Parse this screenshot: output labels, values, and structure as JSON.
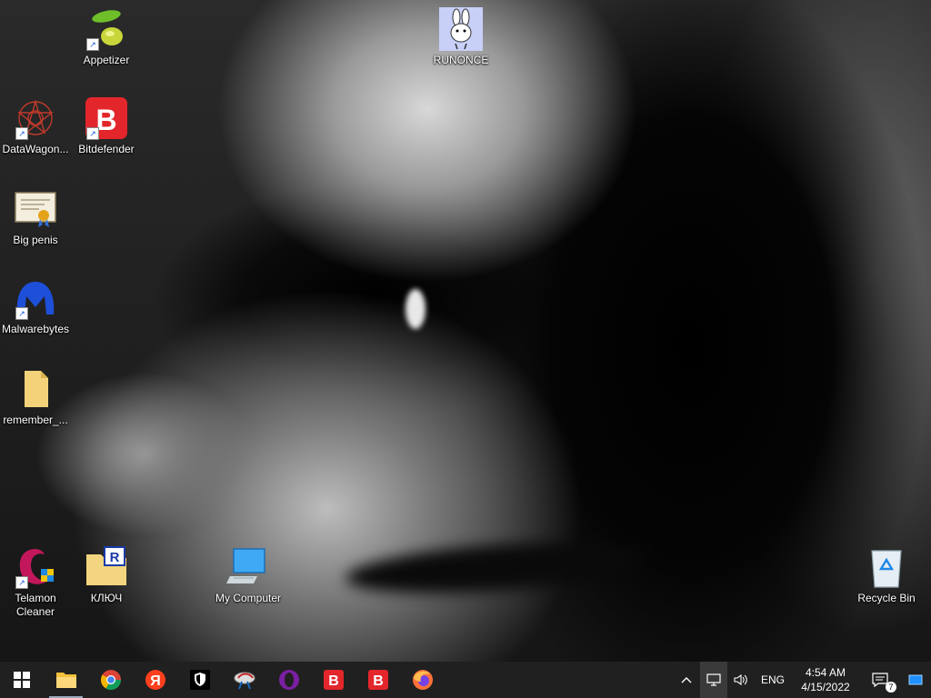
{
  "desktop": {
    "icons": [
      {
        "label": "Appetizer"
      },
      {
        "label": "RUNONCE"
      },
      {
        "label": "DataWagon..."
      },
      {
        "label": "Bitdefender"
      },
      {
        "label": "Big penis"
      },
      {
        "label": "Malwarebytes"
      },
      {
        "label": "remember_..."
      },
      {
        "label": "Telamon Cleaner"
      },
      {
        "label": "КЛЮЧ"
      },
      {
        "label": "My Computer"
      },
      {
        "label": "Recycle Bin"
      }
    ]
  },
  "taskbar": {
    "apps": [
      {
        "icon": "file-explorer-icon"
      },
      {
        "icon": "chrome-icon"
      },
      {
        "icon": "yandex-browser-icon"
      },
      {
        "icon": "security-shield-icon"
      },
      {
        "icon": "network-tool-icon"
      },
      {
        "icon": "opera-icon"
      },
      {
        "icon": "bitdefender-icon"
      },
      {
        "icon": "bitdefender-icon"
      },
      {
        "icon": "firefox-icon"
      }
    ],
    "tray": {
      "language": "ENG",
      "time": "4:54 AM",
      "date": "4/15/2022",
      "notification_count": "7"
    }
  },
  "colors": {
    "taskbar": "#202020",
    "bitdefender_red": "#e3262b",
    "windows_blue": "#1e90ff"
  }
}
